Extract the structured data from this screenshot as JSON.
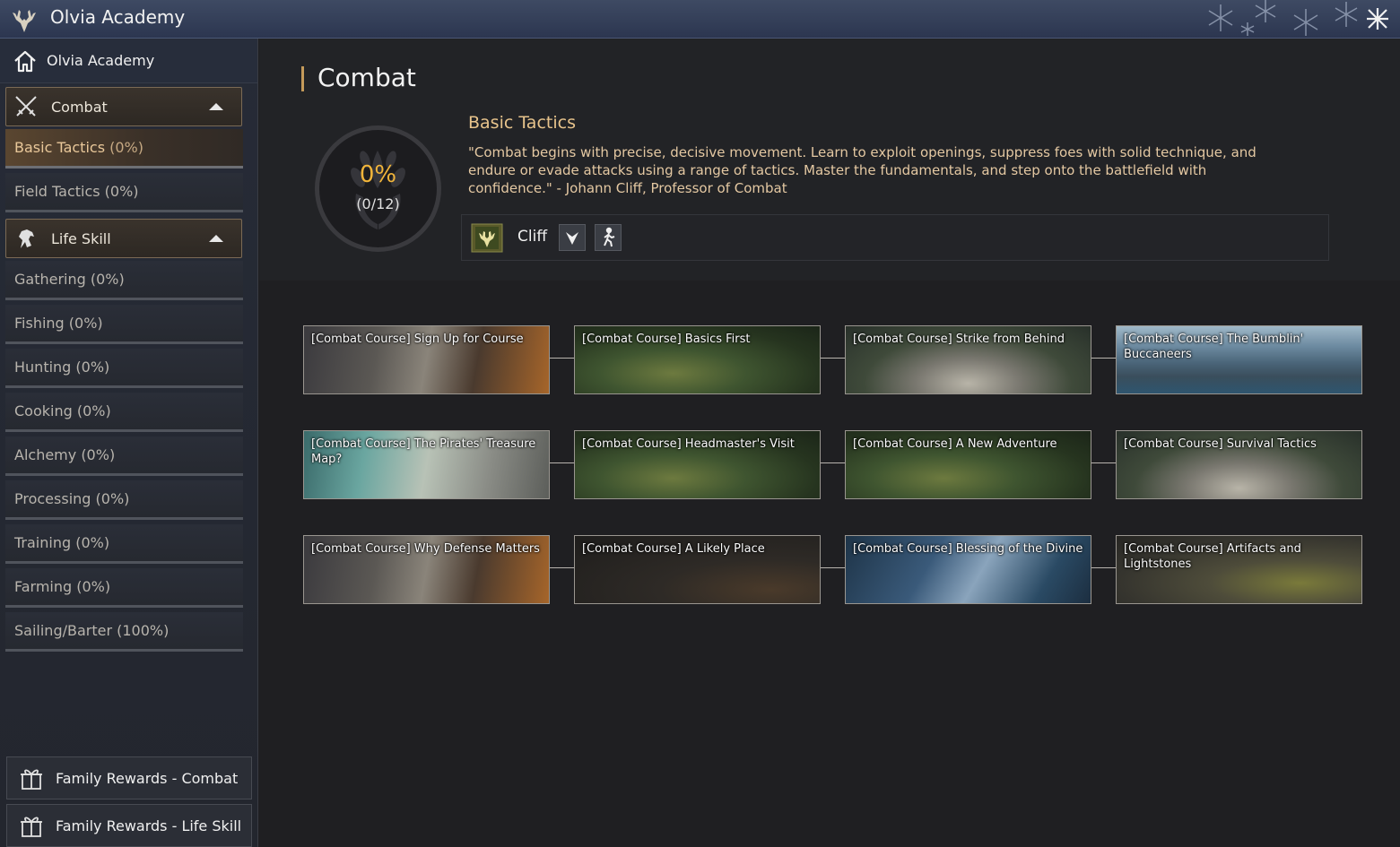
{
  "window": {
    "title": "Olvia Academy"
  },
  "sidebar": {
    "home_label": "Olvia Academy",
    "categories": [
      {
        "label": "Combat",
        "icon": "crossed-swords-icon"
      },
      {
        "label": "Life Skill",
        "icon": "horse-icon"
      }
    ],
    "combat_items": [
      {
        "label": "Basic Tactics",
        "pct": "(0%)",
        "active": true
      },
      {
        "label": "Field Tactics (0%)"
      }
    ],
    "life_items": [
      {
        "label": "Gathering (0%)"
      },
      {
        "label": "Fishing (0%)"
      },
      {
        "label": "Hunting (0%)"
      },
      {
        "label": "Cooking (0%)"
      },
      {
        "label": "Alchemy (0%)"
      },
      {
        "label": "Processing (0%)"
      },
      {
        "label": "Training (0%)"
      },
      {
        "label": "Farming (0%)"
      },
      {
        "label": "Sailing/Barter (100%)"
      }
    ],
    "rewards": [
      {
        "label": "Family Rewards - Combat"
      },
      {
        "label": "Family Rewards - Life Skill"
      }
    ]
  },
  "main": {
    "title": "Combat",
    "progress": {
      "percent_text": "0%",
      "count_text": "(0/12)",
      "fraction": 0
    },
    "course_title": "Basic Tactics",
    "course_description": "\"Combat begins with precise, decisive movement. Learn to exploit openings, suppress foes with solid technique, and endure or evade attacks using a range of tactics. Master the fundamentals, and step onto the battlefield with confidence.\" - Johann Cliff, Professor of Combat",
    "npc": {
      "name": "Cliff"
    },
    "quests": [
      {
        "label": "[Combat Course] Sign Up for Course",
        "scene": "camp"
      },
      {
        "label": "[Combat Course] Basics First",
        "scene": "field"
      },
      {
        "label": "[Combat Course] Strike from Behind",
        "scene": "arena"
      },
      {
        "label": "[Combat Course] The Bumblin' Buccaneers",
        "scene": "harbor"
      },
      {
        "label": "[Combat Course] The Pirates' Treasure Map?",
        "scene": "map"
      },
      {
        "label": "[Combat Course] Headmaster's Visit",
        "scene": "field"
      },
      {
        "label": "[Combat Course] A New Adventure",
        "scene": "field"
      },
      {
        "label": "[Combat Course] Survival Tactics",
        "scene": "arena"
      },
      {
        "label": "[Combat Course] Why Defense Matters",
        "scene": "camp"
      },
      {
        "label": "[Combat Course] A Likely Place",
        "scene": "cave"
      },
      {
        "label": "[Combat Course] Blessing of the Divine",
        "scene": "divine"
      },
      {
        "label": "[Combat Course] Artifacts and Lightstones",
        "scene": "ruins"
      }
    ]
  },
  "colors": {
    "accent": "#c49a5a",
    "progress": "#f0b43a",
    "active_text": "#e9c89a"
  }
}
